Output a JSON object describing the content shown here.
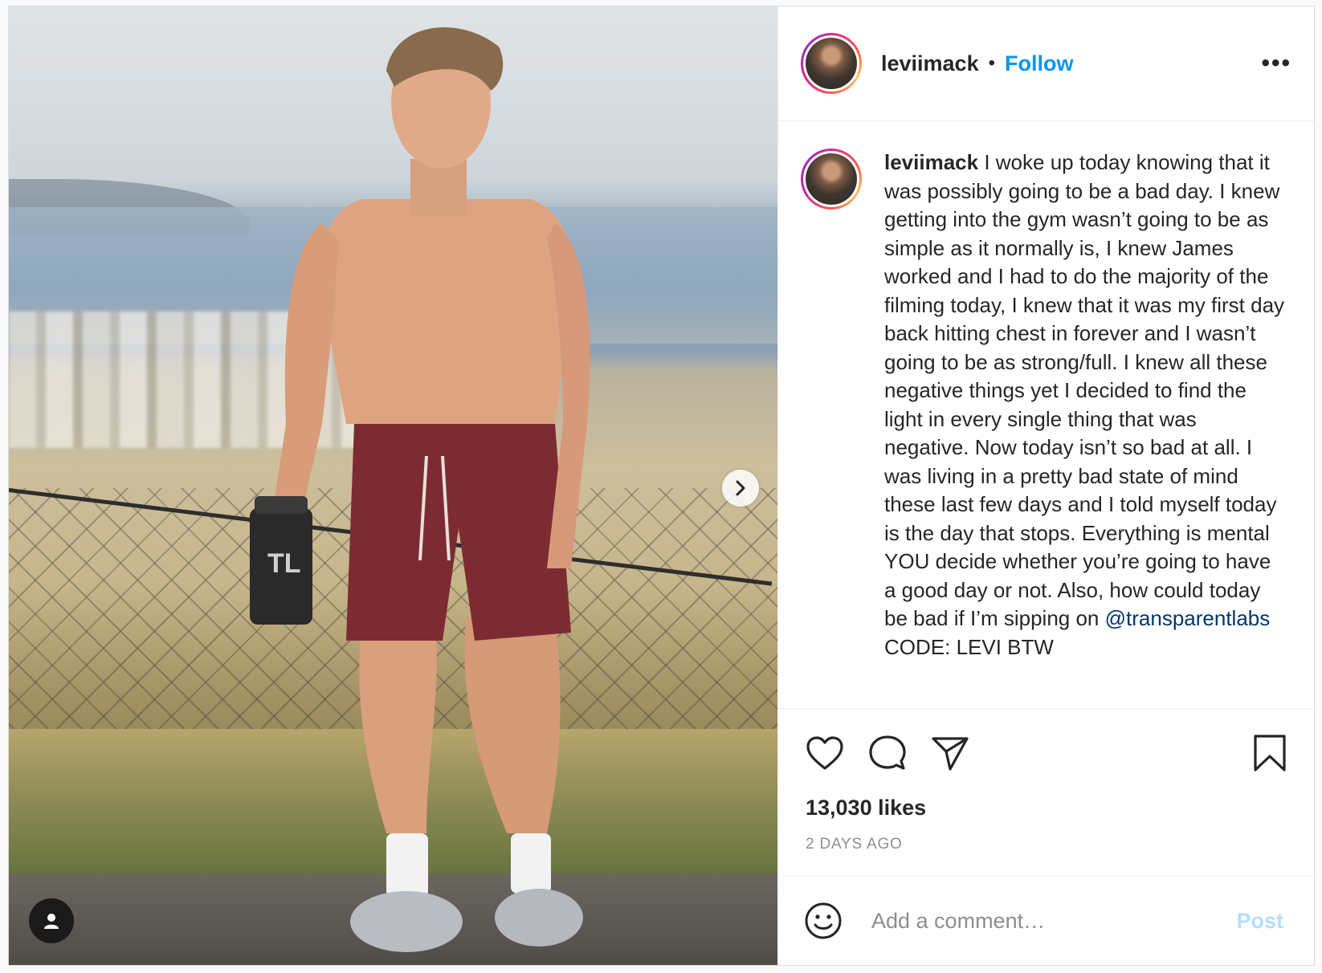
{
  "header": {
    "username": "leviimack",
    "separator": "•",
    "follow_label": "Follow",
    "more_label": "•••"
  },
  "caption": {
    "username": "leviimack",
    "text_before_mention": "I woke up today knowing that it was possibly going to be a bad day. I knew getting into the gym wasn’t going to be as simple as it normally is, I knew James worked and I had to do the majority of the filming today, I knew that it was my first day back hitting chest in forever and I wasn’t going to be as strong/full. I knew all these negative things yet I decided to find the light in every single thing that was negative. Now today isn’t so bad at all. I was living in a pretty bad state of mind these last few days and I told myself today is the day that stops. Everything is mental YOU decide whether you’re going to have a good day or not. Also, how could today be bad if I’m sipping on",
    "mention": "@transparentlabs",
    "text_after_mention": "CODE: LEVI BTW"
  },
  "stats": {
    "likes": "13,030 likes",
    "posted": "2 DAYS AGO"
  },
  "comment": {
    "placeholder": "Add a comment…",
    "post_label": "Post"
  },
  "colors": {
    "link_blue": "#0095f6",
    "mention_blue": "#00376b",
    "muted": "#8e8e8e",
    "post_disabled": "#b2dffc"
  },
  "icons": {
    "next": "chevron-right-icon",
    "tag": "user-tag-icon",
    "like": "heart-icon",
    "comment": "comment-bubble-icon",
    "share": "paper-plane-icon",
    "save": "bookmark-icon",
    "emoji": "smiley-icon"
  }
}
